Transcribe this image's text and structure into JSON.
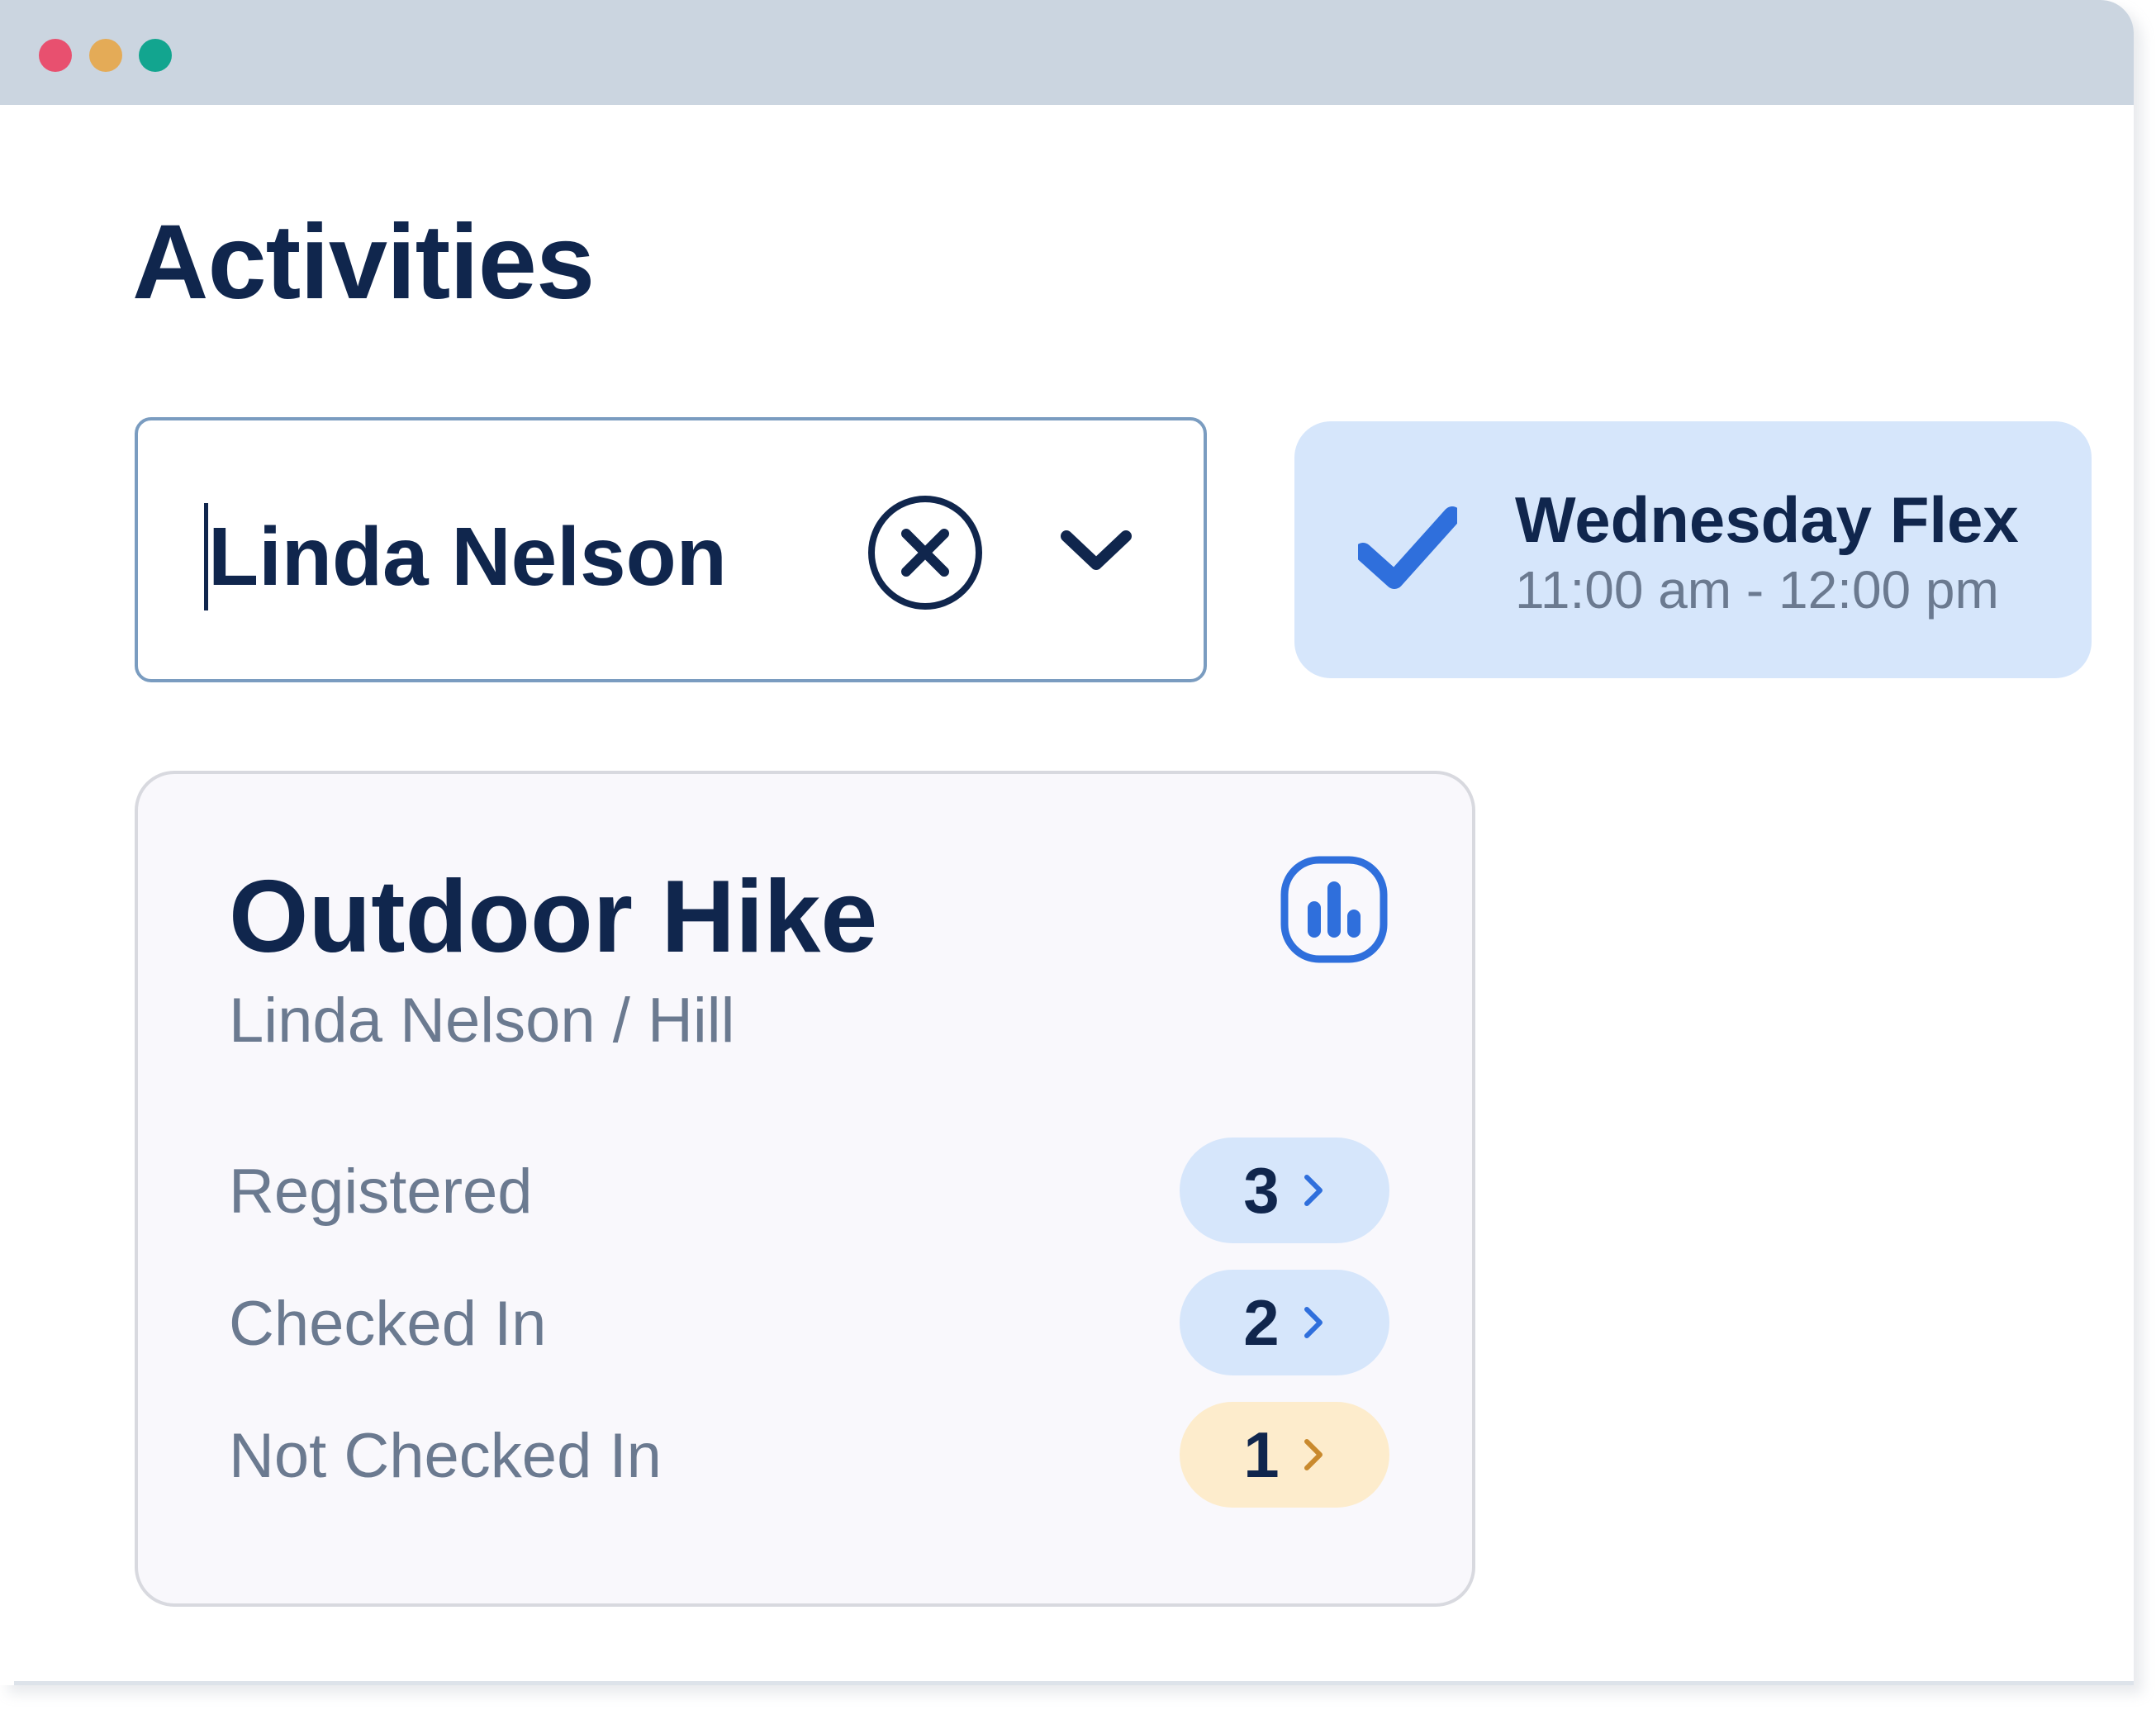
{
  "window": {
    "controls": [
      "close",
      "minimize",
      "maximize"
    ],
    "colors": {
      "close": "#e8506f",
      "minimize": "#e4ab57",
      "maximize": "#12a58f"
    }
  },
  "page": {
    "title": "Activities"
  },
  "filter": {
    "value": "Linda Nelson",
    "clear_icon": "close-circle-icon",
    "dropdown_icon": "chevron-down-icon"
  },
  "session": {
    "name": "Wednesday Flex",
    "time": "11:00 am - 12:00 pm",
    "selected": true,
    "icon": "check-icon"
  },
  "activity": {
    "title": "Outdoor Hike",
    "subtitle": "Linda Nelson / Hill",
    "stats_icon": "bar-chart-icon",
    "stats": [
      {
        "label": "Registered",
        "count": "3",
        "tone": "blue"
      },
      {
        "label": "Checked In",
        "count": "2",
        "tone": "blue"
      },
      {
        "label": "Not Checked In",
        "count": "1",
        "tone": "amber"
      }
    ]
  },
  "colors": {
    "primary_text": "#10264d",
    "secondary_text": "#6b7a90",
    "accent_blue": "#2f6fdc",
    "pill_blue": "#d6e6fb",
    "pill_amber": "#fdeccc",
    "chevron_amber": "#c98a2e"
  }
}
